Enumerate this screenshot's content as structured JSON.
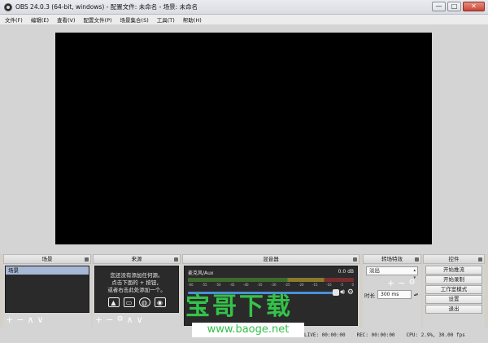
{
  "window": {
    "title": "OBS 24.0.3 (64-bit, windows) - 配置文件: 未命名 - 场景: 未命名",
    "minimize_glyph": "—",
    "maximize_glyph": "□",
    "close_glyph": "✕"
  },
  "menu": [
    "文件(F)",
    "编辑(E)",
    "查看(V)",
    "配置文件(P)",
    "场景集合(S)",
    "工具(T)",
    "帮助(H)"
  ],
  "scenes": {
    "title": "场景",
    "items": [
      "场景"
    ],
    "tools": [
      "+",
      "−",
      "∧",
      "∨"
    ]
  },
  "sources": {
    "title": "来源",
    "empty_lines": [
      "您还没有添加任何源。",
      "点击下面的 + 按钮，",
      "或者右击此处添加一个。"
    ],
    "tools": [
      "+",
      "−",
      "⚙",
      "∧",
      "∨"
    ]
  },
  "mixer": {
    "title": "混音器",
    "channel": "麦克风/Aux",
    "db": "0.0 dB",
    "scale": [
      "-60",
      "-55",
      "-50",
      "-45",
      "-40",
      "-35",
      "-30",
      "-25",
      "-20",
      "-15",
      "-10",
      "-5",
      "0"
    ],
    "volume_level": 1.0
  },
  "transitions": {
    "title": "转场特效",
    "selected": "淡出",
    "duration_label": "时长",
    "duration_value": "300 ms",
    "tools": [
      "+",
      "−",
      "⚙"
    ]
  },
  "controls": {
    "title": "控件",
    "buttons": [
      "开始推流",
      "开始录制",
      "工作室模式",
      "设置",
      "退出"
    ]
  },
  "status": {
    "live": "LIVE: 00:00:00",
    "rec": "REC: 00:00:00",
    "cpu": "CPU: 2.9%, 30.00 fps"
  },
  "watermark": {
    "logo_text": "宝哥下载",
    "url": "www.baoge.net"
  }
}
